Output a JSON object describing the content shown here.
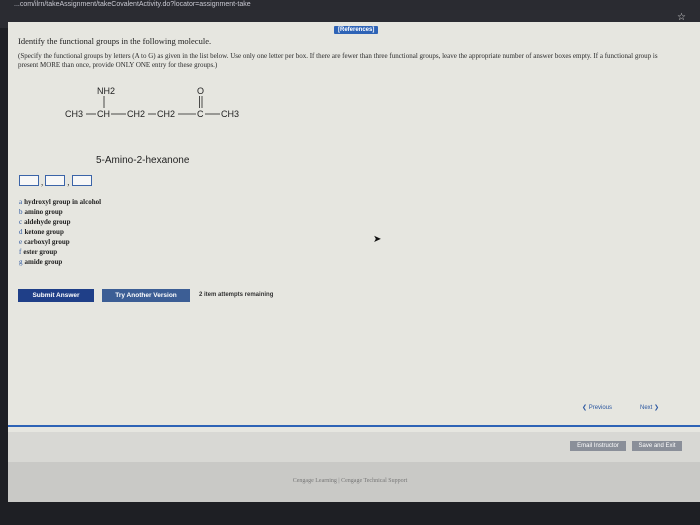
{
  "browser": {
    "url": "...com/ilrn/takeAssignment/takeCovalentActivity.do?locator=assignment-take"
  },
  "references_label": "[References]",
  "question": {
    "title": "Identify the functional groups in the following molecule.",
    "instructions": "(Specify the functional groups by letters (A to G) as given in the list below. Use only one letter per box. If there are fewer than three functional groups, leave the appropriate number of answer boxes empty. If a functional group is present MORE than once, provide ONLY ONE entry for these groups.)"
  },
  "molecule": {
    "substituent_top_left": "NH2",
    "substituent_top_right": "O",
    "chain": [
      "CH3",
      "CH",
      "CH2",
      "CH2",
      "C",
      "CH3"
    ],
    "name": "5-Amino-2-hexanone"
  },
  "answer_boxes": [
    "",
    "",
    ""
  ],
  "groups": [
    {
      "letter": "a",
      "label": "hydroxyl group in alcohol"
    },
    {
      "letter": "b",
      "label": "amino group"
    },
    {
      "letter": "c",
      "label": "aldehyde group"
    },
    {
      "letter": "d",
      "label": "ketone group"
    },
    {
      "letter": "e",
      "label": "carboxyl group"
    },
    {
      "letter": "f",
      "label": "ester group"
    },
    {
      "letter": "g",
      "label": "amide group"
    }
  ],
  "buttons": {
    "submit": "Submit Answer",
    "another": "Try Another Version",
    "attempts": "2 item attempts remaining",
    "previous": "Previous",
    "next": "Next",
    "email": "Email Instructor",
    "save": "Save and Exit"
  },
  "footer": "Cengage Learning | Cengage Technical Support"
}
